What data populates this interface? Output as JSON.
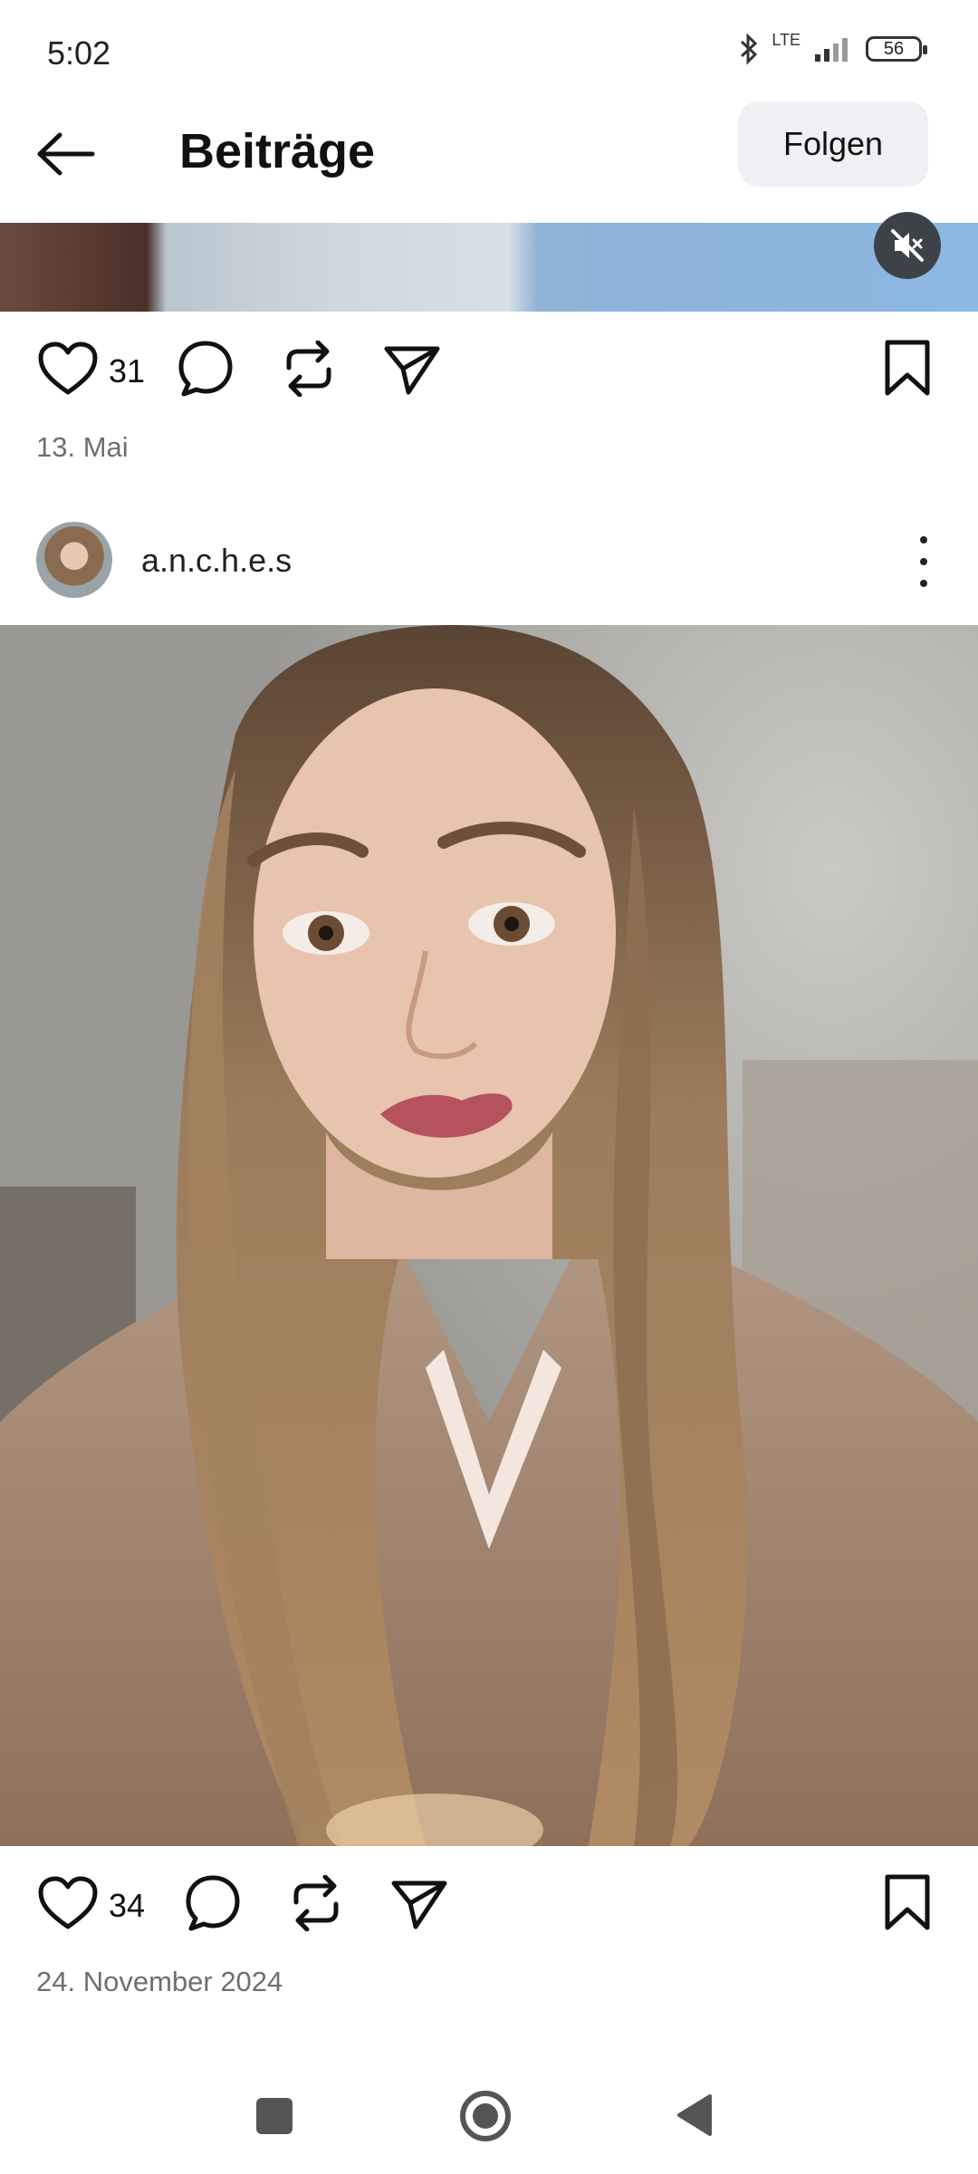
{
  "status_bar": {
    "time": "5:02",
    "network": "LTE",
    "battery": "56"
  },
  "header": {
    "title": "Beiträge",
    "follow_label": "Folgen"
  },
  "posts": [
    {
      "likes": "31",
      "date": "13. Mai"
    },
    {
      "username": "a.n.c.h.e.s",
      "likes": "34",
      "date": "24. November 2024"
    }
  ],
  "icons": {
    "back": "arrow-left-icon",
    "mute": "speaker-muted-icon",
    "like": "heart-icon",
    "comment": "comment-bubble-icon",
    "repost": "repost-icon",
    "share": "paper-plane-icon",
    "save": "bookmark-icon",
    "more": "vertical-dots-icon"
  },
  "colors": {
    "follow_bg": "#eef0f4",
    "date_text": "#6f6f6f",
    "icon": "#111111"
  }
}
